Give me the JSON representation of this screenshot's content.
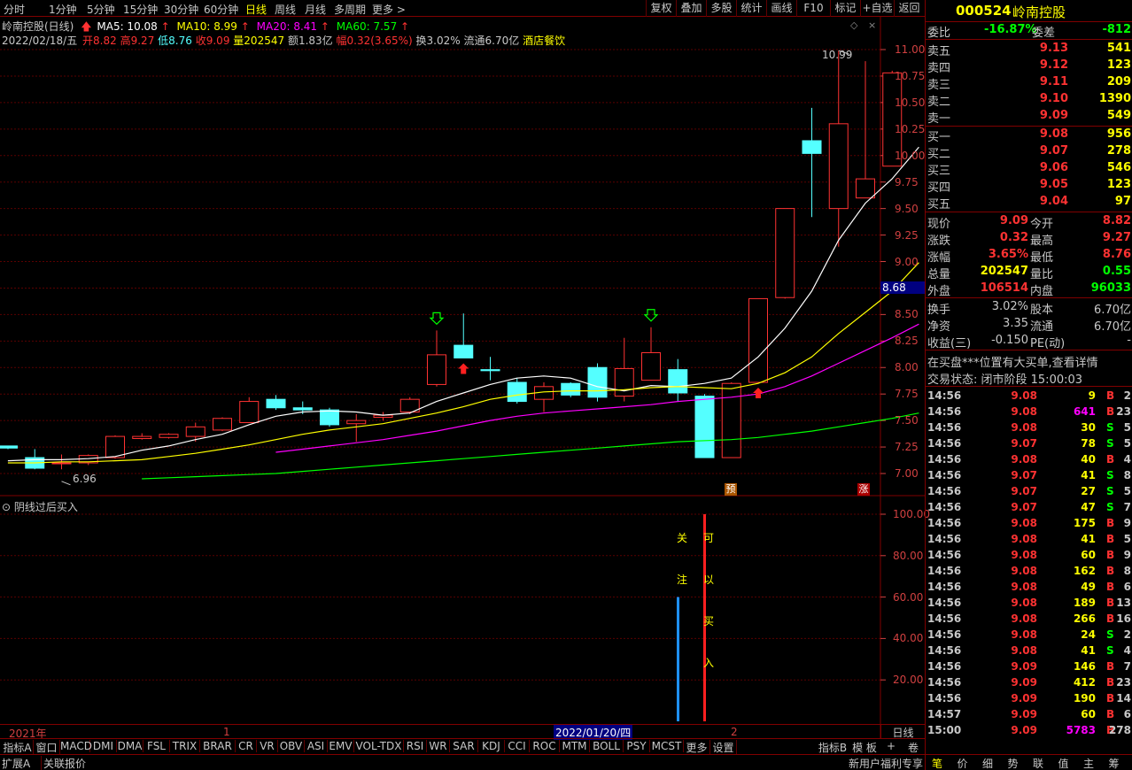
{
  "periods": [
    "分时",
    "1分钟",
    "5分钟",
    "15分钟",
    "30分钟",
    "60分钟",
    "日线",
    "周线",
    "月线",
    "多周期",
    "更多 >"
  ],
  "active_period": "日线",
  "toolbar_right": [
    "复权",
    "叠加",
    "多股",
    "统计",
    "画线",
    "F10",
    "标记",
    "+自选",
    "返回"
  ],
  "info_line1": {
    "name": "岭南控股(日线)",
    "ma5": "MA5: 10.08",
    "ma10": "MA10: 8.99",
    "ma20": "MA20: 8.41",
    "ma60": "MA60: 7.57"
  },
  "info_line2": {
    "date": "2022/02/18/五",
    "open": "开8.82",
    "high": "高9.27",
    "low": "低8.76",
    "close": "收9.09",
    "volume": "量202547",
    "amount": "额1.83亿",
    "change": "幅0.32(3.65%)",
    "turnover": "换3.02%",
    "float": "流通6.70亿",
    "industry": "酒店餐饮"
  },
  "colors": {
    "ma5": "#ffffff",
    "ma10": "#ffff00",
    "ma20": "#ff00ff",
    "ma60": "#00ff00",
    "up": "#ff3232",
    "down": "#54ffff",
    "grid": "#600000",
    "axis": "#d04040"
  },
  "price_axis": [
    "11.00",
    "10.75",
    "10.50",
    "10.25",
    "10.00",
    "9.75",
    "9.50",
    "9.25",
    "9.00",
    "8.75",
    "8.50",
    "8.25",
    "8.00",
    "7.75",
    "7.50",
    "7.25",
    "7.00"
  ],
  "price_cursor_label": "8.68",
  "max_label": "10.99",
  "min_label": "6.96",
  "marker_yu": "预",
  "marker_zhang": "涨",
  "chart_data": {
    "type": "candlestick",
    "ylim": [
      6.88,
      11.12
    ],
    "candles": [
      {
        "o": 7.26,
        "c": 7.24,
        "h": 7.25,
        "l": 7.23
      },
      {
        "o": 7.15,
        "c": 7.05,
        "h": 7.23,
        "l": 7.04
      },
      {
        "o": 7.1,
        "c": 7.1,
        "h": 7.18,
        "l": 7.04
      },
      {
        "o": 7.1,
        "c": 7.17,
        "h": 7.18,
        "l": 7.08
      },
      {
        "o": 7.15,
        "c": 7.35,
        "h": 7.36,
        "l": 7.14
      },
      {
        "o": 7.33,
        "c": 7.35,
        "h": 7.38,
        "l": 7.32
      },
      {
        "o": 7.34,
        "c": 7.37,
        "h": 7.38,
        "l": 7.33
      },
      {
        "o": 7.35,
        "c": 7.44,
        "h": 7.48,
        "l": 7.3
      },
      {
        "o": 7.41,
        "c": 7.52,
        "h": 7.53,
        "l": 7.4
      },
      {
        "o": 7.48,
        "c": 7.68,
        "h": 7.72,
        "l": 7.48
      },
      {
        "o": 7.7,
        "c": 7.62,
        "h": 7.74,
        "l": 7.6
      },
      {
        "o": 7.62,
        "c": 7.6,
        "h": 7.68,
        "l": 7.56
      },
      {
        "o": 7.6,
        "c": 7.46,
        "h": 7.62,
        "l": 7.44
      },
      {
        "o": 7.47,
        "c": 7.5,
        "h": 7.56,
        "l": 7.3
      },
      {
        "o": 7.53,
        "c": 7.55,
        "h": 7.58,
        "l": 7.5
      },
      {
        "o": 7.58,
        "c": 7.7,
        "h": 7.72,
        "l": 7.56
      },
      {
        "o": 7.84,
        "c": 8.12,
        "h": 8.35,
        "l": 7.82
      },
      {
        "o": 8.21,
        "c": 8.09,
        "h": 8.51,
        "l": 8.09
      },
      {
        "o": 7.98,
        "c": 7.97,
        "h": 8.1,
        "l": 7.88
      },
      {
        "o": 7.86,
        "c": 7.68,
        "h": 7.9,
        "l": 7.66
      },
      {
        "o": 7.7,
        "c": 7.82,
        "h": 7.86,
        "l": 7.58
      },
      {
        "o": 7.85,
        "c": 7.74,
        "h": 7.86,
        "l": 7.72
      },
      {
        "o": 8.0,
        "c": 7.72,
        "h": 8.04,
        "l": 7.68
      },
      {
        "o": 7.73,
        "c": 7.99,
        "h": 8.28,
        "l": 7.68
      },
      {
        "o": 7.88,
        "c": 8.14,
        "h": 8.38,
        "l": 7.88
      },
      {
        "o": 7.98,
        "c": 7.76,
        "h": 8.08,
        "l": 7.68
      },
      {
        "o": 7.73,
        "c": 7.15,
        "h": 7.75,
        "l": 7.15
      },
      {
        "o": 7.15,
        "c": 7.85,
        "h": 7.86,
        "l": 7.15
      },
      {
        "o": 7.86,
        "c": 8.65,
        "h": 8.65,
        "l": 7.86
      },
      {
        "o": 8.66,
        "c": 9.5,
        "h": 9.5,
        "l": 8.65
      },
      {
        "o": 10.14,
        "c": 10.02,
        "h": 10.45,
        "l": 9.42
      },
      {
        "o": 9.5,
        "c": 10.3,
        "h": 10.99,
        "l": 9.14
      },
      {
        "o": 9.6,
        "c": 9.78,
        "h": 10.89,
        "l": 9.6
      },
      {
        "o": 9.9,
        "c": 10.78,
        "h": 10.8,
        "l": 9.9
      }
    ],
    "ma5": [
      7.12,
      7.13,
      7.13,
      7.14,
      7.16,
      7.22,
      7.26,
      7.32,
      7.37,
      7.46,
      7.54,
      7.58,
      7.59,
      7.58,
      7.55,
      7.57,
      7.68,
      7.76,
      7.84,
      7.9,
      7.92,
      7.9,
      7.82,
      7.78,
      7.83,
      7.82,
      7.85,
      7.9,
      8.1,
      8.37,
      8.72,
      9.2,
      9.55,
      9.78,
      10.08
    ],
    "ma10": [
      7.1,
      7.1,
      7.11,
      7.11,
      7.12,
      7.13,
      7.16,
      7.19,
      7.23,
      7.27,
      7.32,
      7.37,
      7.41,
      7.44,
      7.47,
      7.52,
      7.57,
      7.63,
      7.7,
      7.74,
      7.77,
      7.78,
      7.78,
      7.79,
      7.81,
      7.82,
      7.81,
      7.8,
      7.85,
      7.95,
      8.1,
      8.32,
      8.52,
      8.72,
      8.99
    ],
    "ma20": [
      null,
      null,
      null,
      null,
      null,
      null,
      null,
      null,
      null,
      null,
      7.2,
      7.23,
      7.26,
      7.29,
      7.32,
      7.36,
      7.4,
      7.45,
      7.5,
      7.54,
      7.57,
      7.59,
      7.61,
      7.63,
      7.65,
      7.68,
      7.7,
      7.72,
      7.75,
      7.82,
      7.92,
      8.04,
      8.16,
      8.28,
      8.41
    ],
    "ma60": [
      null,
      null,
      null,
      null,
      null,
      6.95,
      6.96,
      6.97,
      6.98,
      6.99,
      7.0,
      7.02,
      7.04,
      7.06,
      7.08,
      7.1,
      7.12,
      7.14,
      7.16,
      7.18,
      7.2,
      7.22,
      7.24,
      7.26,
      7.28,
      7.3,
      7.31,
      7.32,
      7.34,
      7.37,
      7.4,
      7.44,
      7.48,
      7.52,
      7.57
    ],
    "signals": [
      {
        "index": 16,
        "type": "down-arrow"
      },
      {
        "index": 17,
        "type": "up-arrow"
      },
      {
        "index": 24,
        "type": "down-arrow"
      },
      {
        "index": 28,
        "type": "up-arrow"
      }
    ]
  },
  "indicator": {
    "title": "阴线过后买入",
    "axis": [
      "100.00",
      "80.00",
      "60.00",
      "40.00",
      "20.00"
    ],
    "ylim": [
      0,
      100
    ],
    "bars": [
      {
        "index": 25,
        "value": 60,
        "color": "#1e90ff"
      },
      {
        "index": 26,
        "value": 100,
        "color": "#ff2020"
      }
    ],
    "text_attention": [
      "关",
      "注"
    ],
    "text_buy": [
      "可",
      "以",
      "买",
      "入"
    ]
  },
  "timeline": {
    "year": "2021年",
    "m1": "1",
    "cursor_date": "2022/01/20/四",
    "m2": "2",
    "label_right": "日线"
  },
  "indicator_tabs": [
    "指标A",
    "窗口",
    "MACD",
    "DMI",
    "DMA",
    "FSL",
    "TRIX",
    "BRAR",
    "CR",
    "VR",
    "OBV",
    "ASI",
    "EMV",
    "VOL-TDX",
    "RSI",
    "WR",
    "SAR",
    "KDJ",
    "CCI",
    "ROC",
    "MTM",
    "BOLL",
    "PSY",
    "MCST",
    "更多",
    "设置"
  ],
  "indicator_b": [
    "指标B",
    "模 板",
    "+",
    "卷"
  ],
  "status_left": [
    "扩展A",
    "关联报价"
  ],
  "status_right": "新用户福利专享",
  "status_icons": [
    "笔",
    "价",
    "细",
    "势",
    "联",
    "值",
    "主",
    "筹"
  ],
  "stock": {
    "code": "000524",
    "name": "岭南控股"
  },
  "weibi": {
    "label": "委比",
    "value": "-16.87%",
    "diff_label": "委差",
    "diff": "-812"
  },
  "asks": [
    {
      "label": "卖五",
      "price": "9.13",
      "vol": "541"
    },
    {
      "label": "卖四",
      "price": "9.12",
      "vol": "123"
    },
    {
      "label": "卖三",
      "price": "9.11",
      "vol": "209"
    },
    {
      "label": "卖二",
      "price": "9.10",
      "vol": "1390"
    },
    {
      "label": "卖一",
      "price": "9.09",
      "vol": "549"
    }
  ],
  "bids": [
    {
      "label": "买一",
      "price": "9.08",
      "vol": "956"
    },
    {
      "label": "买二",
      "price": "9.07",
      "vol": "278"
    },
    {
      "label": "买三",
      "price": "9.06",
      "vol": "546"
    },
    {
      "label": "买四",
      "price": "9.05",
      "vol": "123"
    },
    {
      "label": "买五",
      "price": "9.04",
      "vol": "97"
    }
  ],
  "quote": [
    {
      "l1": "现价",
      "v1": "9.09",
      "c1": "#ff3232",
      "l2": "今开",
      "v2": "8.82",
      "c2": "#ff3232"
    },
    {
      "l1": "涨跌",
      "v1": "0.32",
      "c1": "#ff3232",
      "l2": "最高",
      "v2": "9.27",
      "c2": "#ff3232"
    },
    {
      "l1": "涨幅",
      "v1": "3.65%",
      "c1": "#ff3232",
      "l2": "最低",
      "v2": "8.76",
      "c2": "#ff3232"
    },
    {
      "l1": "总量",
      "v1": "202547",
      "c1": "#ffff00",
      "l2": "量比",
      "v2": "0.55",
      "c2": "#00ff00"
    },
    {
      "l1": "外盘",
      "v1": "106514",
      "c1": "#ff3232",
      "l2": "内盘",
      "v2": "96033",
      "c2": "#00ff00"
    }
  ],
  "fund": [
    {
      "l1": "换手",
      "v1": "3.02%",
      "l2": "股本",
      "v2": "6.70亿"
    },
    {
      "l1": "净资",
      "v1": "3.35",
      "l2": "流通",
      "v2": "6.70亿"
    },
    {
      "l1": "收益(三)",
      "v1": "-0.150",
      "l2": "PE(动)",
      "v2": "-"
    }
  ],
  "notice": "在买盘***位置有大买单,查看详情",
  "trade_state": "交易状态: 闭市阶段 15:00:03",
  "ticks": [
    {
      "t": "14:56",
      "p": "9.08",
      "v": "9",
      "bs": "B",
      "n": "2"
    },
    {
      "t": "14:56",
      "p": "9.08",
      "v": "641",
      "bs": "B",
      "n": "23"
    },
    {
      "t": "14:56",
      "p": "9.08",
      "v": "30",
      "bs": "S",
      "n": "5"
    },
    {
      "t": "14:56",
      "p": "9.07",
      "v": "78",
      "bs": "S",
      "n": "5"
    },
    {
      "t": "14:56",
      "p": "9.08",
      "v": "40",
      "bs": "B",
      "n": "4"
    },
    {
      "t": "14:56",
      "p": "9.07",
      "v": "41",
      "bs": "S",
      "n": "8"
    },
    {
      "t": "14:56",
      "p": "9.07",
      "v": "27",
      "bs": "S",
      "n": "5"
    },
    {
      "t": "14:56",
      "p": "9.07",
      "v": "47",
      "bs": "S",
      "n": "7"
    },
    {
      "t": "14:56",
      "p": "9.08",
      "v": "175",
      "bs": "B",
      "n": "9"
    },
    {
      "t": "14:56",
      "p": "9.08",
      "v": "41",
      "bs": "B",
      "n": "5"
    },
    {
      "t": "14:56",
      "p": "9.08",
      "v": "60",
      "bs": "B",
      "n": "9"
    },
    {
      "t": "14:56",
      "p": "9.08",
      "v": "162",
      "bs": "B",
      "n": "8"
    },
    {
      "t": "14:56",
      "p": "9.08",
      "v": "49",
      "bs": "B",
      "n": "6"
    },
    {
      "t": "14:56",
      "p": "9.08",
      "v": "189",
      "bs": "B",
      "n": "13"
    },
    {
      "t": "14:56",
      "p": "9.08",
      "v": "266",
      "bs": "B",
      "n": "16"
    },
    {
      "t": "14:56",
      "p": "9.08",
      "v": "24",
      "bs": "S",
      "n": "2"
    },
    {
      "t": "14:56",
      "p": "9.08",
      "v": "41",
      "bs": "S",
      "n": "4"
    },
    {
      "t": "14:56",
      "p": "9.09",
      "v": "146",
      "bs": "B",
      "n": "7"
    },
    {
      "t": "14:56",
      "p": "9.09",
      "v": "412",
      "bs": "B",
      "n": "23"
    },
    {
      "t": "14:56",
      "p": "9.09",
      "v": "190",
      "bs": "B",
      "n": "14"
    },
    {
      "t": "14:57",
      "p": "9.09",
      "v": "60",
      "bs": "B",
      "n": "6"
    },
    {
      "t": "15:00",
      "p": "9.09",
      "v": "5783",
      "bs": "B",
      "n": "278"
    }
  ]
}
